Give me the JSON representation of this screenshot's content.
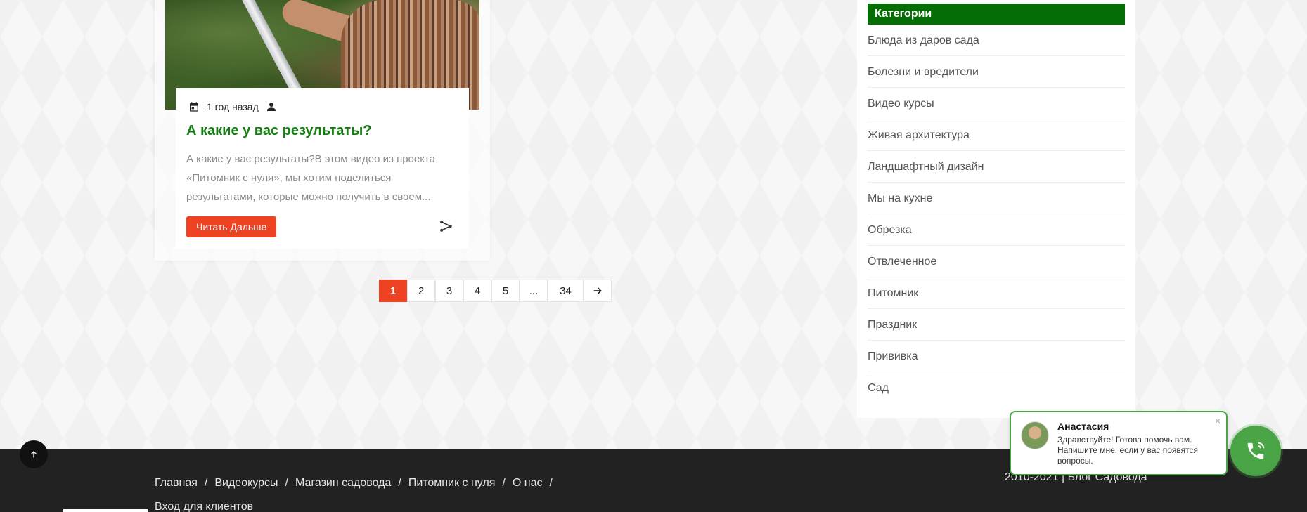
{
  "post": {
    "date": "1 год назад",
    "title": "А какие у вас результаты?",
    "excerpt_lines": [
      "А какие у вас результаты?В этом видео из проекта",
      "«Питомник с нуля», мы хотим поделиться",
      "результатами, которые можно получить в своем..."
    ],
    "read_more": "Читать Дальше",
    "icons": {
      "date": "calendar-icon",
      "author": "user-icon",
      "share": "share-icon"
    }
  },
  "pagination": {
    "pages": [
      "1",
      "2",
      "3",
      "4",
      "5",
      "...",
      "34"
    ],
    "active": "1",
    "next_icon": "arrow-right-icon"
  },
  "sidebar": {
    "heading": "Категории",
    "categories": [
      "Блюда из даров сада",
      "Болезни и вредители",
      "Видео курсы",
      "Живая архитектура",
      "Ландшафтный дизайн",
      "Мы на кухне",
      "Обрезка",
      "Отвлеченное",
      "Питомник",
      "Праздник",
      "Прививка",
      "Сад"
    ]
  },
  "footer": {
    "nav": [
      "Главная",
      "Видеокурсы",
      "Магазин садовода",
      "Питомник с нуля",
      "О нас",
      "Вход для клиентов"
    ],
    "separator": "/",
    "copyright": "2010-2021 | Блог Садовода"
  },
  "chat": {
    "name": "Анастасия",
    "message": "Здравствуйте! Готова помочь вам. Напишите мне, если у вас появятся вопросы.",
    "close": "×",
    "button_icon": "phone-icon"
  },
  "colors": {
    "accent": "#ee4323",
    "green_heading": "#046e05",
    "title_green": "#157e12",
    "chat_green": "#4aa547",
    "footer_bg": "#222222"
  }
}
